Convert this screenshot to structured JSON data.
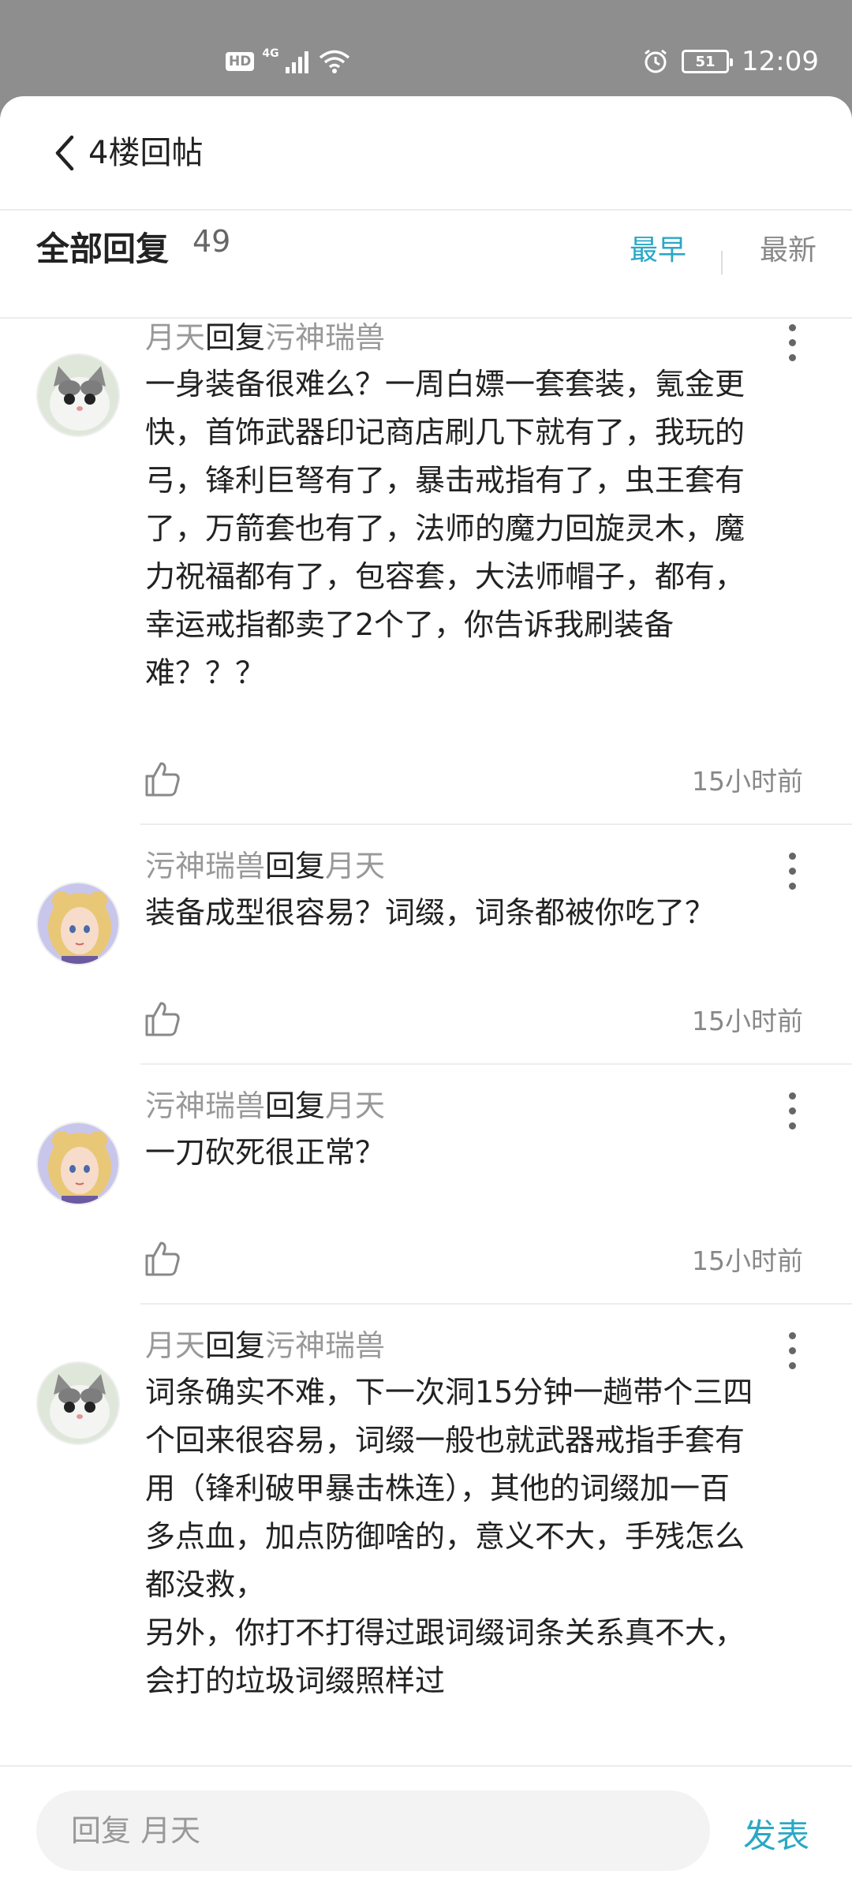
{
  "status_bar": {
    "hd": "HD",
    "network": "4G",
    "battery": "51",
    "time": "12:09"
  },
  "header": {
    "title": "4楼回帖"
  },
  "replies": {
    "label": "全部回复",
    "count": "49",
    "sort_earliest": "最早",
    "sort_latest": "最新"
  },
  "comments": [
    {
      "user": "月天",
      "verb": "回复",
      "target": "污神瑞兽",
      "body": "一身装备很难么？一周白嫖一套套装，氪金更\n快，首饰武器印记商店刷几下就有了，我玩的\n弓，锋利巨弩有了，暴击戒指有了，虫王套有\n了，万箭套也有了，法师的魔力回旋灵木，魔\n力祝福都有了，包容套，大法师帽子，都有，\n幸运戒指都卖了2个了，你告诉我刷装备\n难？？？",
      "time": "15小时前"
    },
    {
      "user": "污神瑞兽",
      "verb": "回复",
      "target": "月天",
      "body": "装备成型很容易？词缀，词条都被你吃了？",
      "time": "15小时前"
    },
    {
      "user": "污神瑞兽",
      "verb": "回复",
      "target": "月天",
      "body": "一刀砍死很正常？",
      "time": "15小时前"
    },
    {
      "user": "月天",
      "verb": "回复",
      "target": "污神瑞兽",
      "body": "词条确实不难，下一次洞15分钟一趟带个三四\n个回来很容易，词缀一般也就武器戒指手套有\n用（锋利破甲暴击株连），其他的词缀加一百\n多点血，加点防御啥的，意义不大，手残怎么\n都没救，\n另外，你打不打得过跟词缀词条关系真不大，\n会打的垃圾词缀照样过",
      "time": ""
    }
  ],
  "bottom": {
    "placeholder": "回复 月天",
    "post_label": "发表"
  },
  "colors": {
    "accent": "#2aa8c4",
    "status_bar_bg": "#8e8e8e"
  }
}
